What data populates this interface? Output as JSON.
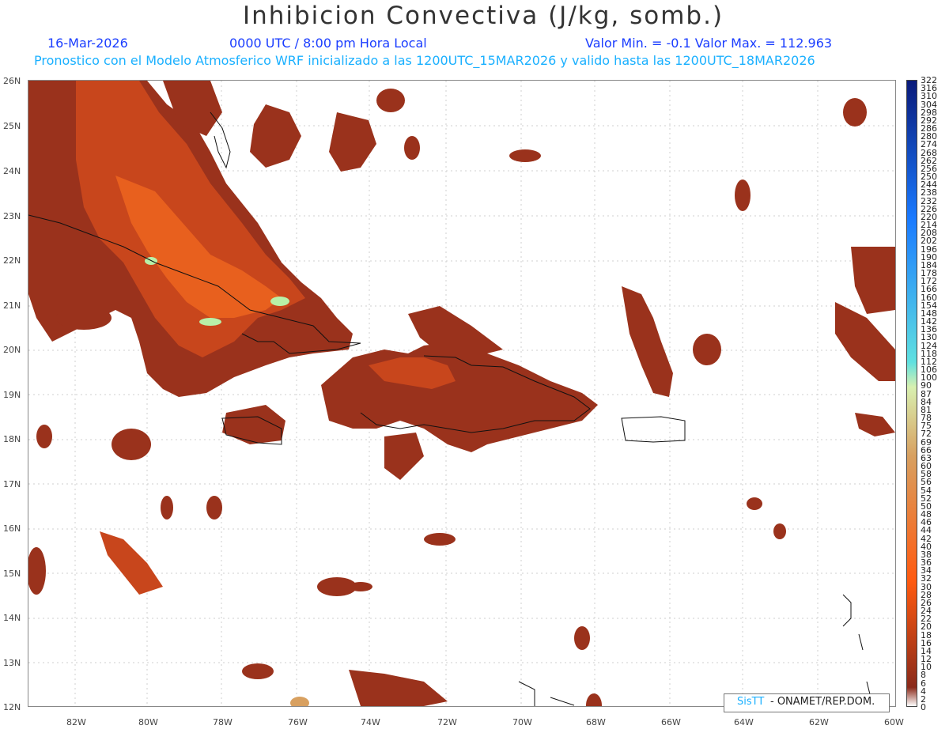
{
  "header": {
    "title": "Inhibicion Convectiva (J/kg, somb.)",
    "date": "16-Mar-2026",
    "time": "0000 UTC / 8:00 pm Hora Local",
    "minmax": "Valor Min. = -0.1  Valor Max. = 112.963",
    "forecast": "Pronostico con el Modelo Atmosferico WRF inicializado a las 1200UTC_15MAR2026 y valido hasta las  1200UTC_18MAR2026"
  },
  "axes": {
    "lat_labels": [
      "26N",
      "25N",
      "24N",
      "23N",
      "22N",
      "21N",
      "20N",
      "19N",
      "18N",
      "17N",
      "16N",
      "15N",
      "14N",
      "13N",
      "12N"
    ],
    "lon_labels": [
      "82W",
      "80W",
      "78W",
      "76W",
      "74W",
      "72W",
      "70W",
      "68W",
      "66W",
      "64W",
      "62W",
      "60W"
    ]
  },
  "colorbar": {
    "labels": [
      "322",
      "316",
      "310",
      "304",
      "298",
      "292",
      "286",
      "280",
      "274",
      "268",
      "262",
      "256",
      "250",
      "244",
      "238",
      "232",
      "226",
      "220",
      "214",
      "208",
      "202",
      "196",
      "190",
      "184",
      "178",
      "172",
      "166",
      "160",
      "154",
      "148",
      "142",
      "136",
      "130",
      "124",
      "118",
      "112",
      "106",
      "100",
      "90",
      "87",
      "84",
      "81",
      "78",
      "75",
      "72",
      "69",
      "66",
      "63",
      "60",
      "58",
      "56",
      "54",
      "52",
      "50",
      "48",
      "46",
      "44",
      "42",
      "40",
      "38",
      "36",
      "34",
      "32",
      "30",
      "28",
      "26",
      "24",
      "22",
      "20",
      "18",
      "16",
      "14",
      "12",
      "10",
      "8",
      "6",
      "4",
      "2",
      "0"
    ],
    "colors": {
      "top": "#0a1a7a",
      "blue": "#1a7aff",
      "cyan": "#5fe0e0",
      "paleyellow": "#d8f0b0",
      "tan": "#d8a060",
      "orange": "#ff5a10",
      "brown": "#8a2a1a"
    }
  },
  "map": {
    "fill_dark": "#8c2e1c",
    "fill_mid": "#c8461c",
    "fill_orange": "#e8601e",
    "fill_light": "#b8f0a8"
  },
  "credit": {
    "logo": "SisTT",
    "text": "- ONAMET/REP.DOM."
  }
}
